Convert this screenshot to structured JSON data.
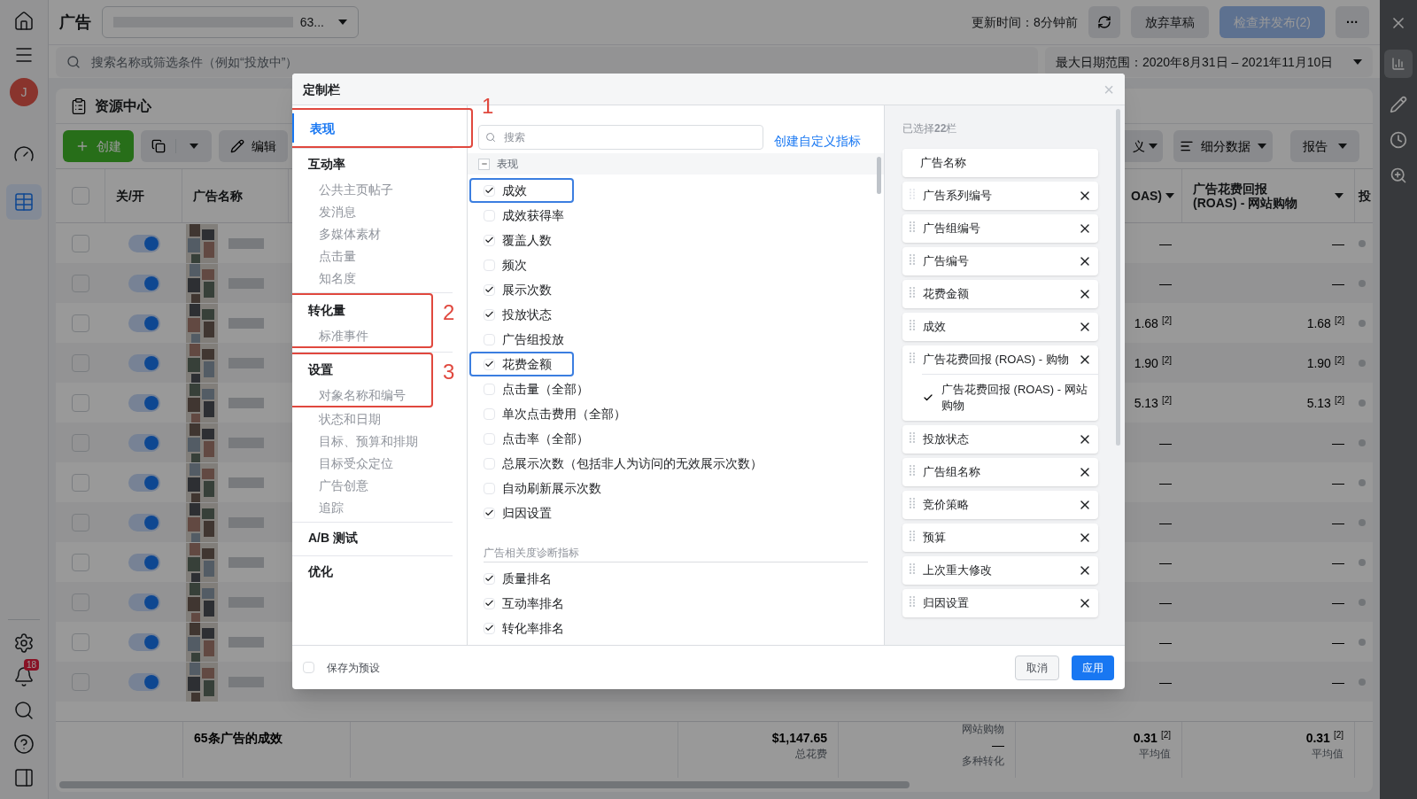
{
  "app_rail": {
    "avatar": "J",
    "notification_badge": "18",
    "items": [
      {
        "kind": "gauge",
        "selected": false
      },
      {
        "kind": "table",
        "selected": true
      }
    ]
  },
  "header": {
    "title": "广告",
    "account_select": "63...",
    "update_time": "更新时间：8分钟前",
    "discard_button": "放弃草稿",
    "publish_button": {
      "label": "检查并发布(2)",
      "disabled": true
    },
    "more_button": "···"
  },
  "search": {
    "placeholder": "搜索名称或筛选条件（例如“投放中”）",
    "date_range": "最大日期范围：2020年8月31日 – 2021年11月10日"
  },
  "resource_center": "资源中心",
  "toolbar": {
    "create": "创建",
    "edit": "编辑",
    "right_buttons": [
      "义",
      "细分数据",
      "报告"
    ]
  },
  "table": {
    "columns": [
      "关/开",
      "广告名称",
      "OAS)",
      "广告花费回报\n(ROAS) - 网站购物",
      "投"
    ],
    "rows": [
      {
        "checked": false,
        "on": true,
        "column_3": "—",
        "column_4": "—"
      },
      {
        "checked": false,
        "on": true,
        "column_3": "—",
        "column_4": "—"
      },
      {
        "checked": false,
        "on": true,
        "column_3": "1.68",
        "note_3": "[2]",
        "column_4": "1.68",
        "note_4": "[2]"
      },
      {
        "checked": false,
        "on": true,
        "column_3": "1.90",
        "note_3": "[2]",
        "column_4": "1.90",
        "note_4": "[2]"
      },
      {
        "checked": false,
        "on": true,
        "column_3": "5.13",
        "note_3": "[2]",
        "column_4": "5.13",
        "note_4": "[2]"
      },
      {
        "checked": false,
        "on": true,
        "column_3": "—",
        "column_4": "—"
      },
      {
        "checked": false,
        "on": true,
        "column_3": "—",
        "column_4": "—"
      },
      {
        "checked": false,
        "on": true,
        "column_3": "—",
        "column_4": "—"
      },
      {
        "checked": false,
        "on": true,
        "column_3": "—",
        "column_4": "—"
      },
      {
        "checked": false,
        "on": true,
        "column_3": "—",
        "column_4": "—"
      },
      {
        "checked": false,
        "on": true,
        "column_3": "—",
        "column_4": "—"
      },
      {
        "checked": false,
        "on": true,
        "column_3": "—",
        "column_4": "—"
      }
    ],
    "all_checked": false,
    "footer": {
      "summary": "65条广告的成效",
      "spend": "$1,147.65",
      "spend_label": "总花费",
      "peek": "网站购物",
      "conversions": "—",
      "conversions_label": "多种转化",
      "roas_1": "0.31",
      "note_1": "[2]",
      "average_label_1": "平均值",
      "roas_2": "0.31",
      "note_2": "[2]",
      "average_label_2": "平均值"
    }
  },
  "dialog": {
    "title": "定制栏",
    "close": "×",
    "nav": [
      {
        "label": "表现",
        "selected": true,
        "annotation": "1"
      },
      {
        "label": "互动率",
        "selected": false,
        "items": [
          "公共主页帖子",
          "发消息",
          "多媒体素材",
          "点击量",
          "知名度"
        ]
      },
      {
        "label": "转化量",
        "selected": false,
        "annotation": "2",
        "items": [
          "标准事件"
        ]
      },
      {
        "label": "设置",
        "selected": false,
        "annotation": "3",
        "items": [
          "对象名称和编号",
          "状态和日期",
          "目标、预算和排期",
          "目标受众定位",
          "广告创意",
          "追踪"
        ]
      },
      {
        "label": "A/B 测试",
        "selected": false
      },
      {
        "label": "优化",
        "selected": false
      }
    ],
    "search_placeholder": "搜索",
    "create_metric_link": "创建自定义指标",
    "sections": [
      {
        "title": "表现",
        "kind": "collapsible",
        "metrics": [
          {
            "label": "成效",
            "checked": true,
            "highlighted": true
          },
          {
            "label": "成效获得率",
            "checked": false,
            "highlighted": false
          },
          {
            "label": "覆盖人数",
            "checked": true,
            "highlighted": false
          },
          {
            "label": "频次",
            "checked": false,
            "highlighted": false
          },
          {
            "label": "展示次数",
            "checked": true,
            "highlighted": false
          },
          {
            "label": "投放状态",
            "checked": true,
            "highlighted": false
          },
          {
            "label": "广告组投放",
            "checked": false,
            "highlighted": false
          },
          {
            "label": "花费金额",
            "checked": true,
            "highlighted": true
          },
          {
            "label": "点击量（全部）",
            "checked": false,
            "highlighted": false
          },
          {
            "label": "单次点击费用（全部）",
            "checked": false,
            "highlighted": false
          },
          {
            "label": "点击率（全部）",
            "checked": false,
            "highlighted": false
          },
          {
            "label": "总展示次数（包括非人为访问的无效展示次数）",
            "checked": false,
            "highlighted": false
          },
          {
            "label": "自动刷新展示次数",
            "checked": false,
            "highlighted": false
          },
          {
            "label": "归因设置",
            "checked": true,
            "highlighted": false
          }
        ]
      },
      {
        "title": "广告相关度诊断指标",
        "kind": "plain",
        "metrics": [
          {
            "label": "质量排名",
            "checked": true,
            "highlighted": false
          },
          {
            "label": "互动率排名",
            "checked": true,
            "highlighted": false
          },
          {
            "label": "转化率排名",
            "checked": true,
            "highlighted": false
          }
        ]
      }
    ],
    "selected_count": "已选择**22**栏",
    "selected_columns": [
      {
        "label": "广告名称",
        "locked": true
      },
      {
        "label": "广告系列编号",
        "locked": false
      },
      {
        "label": "广告组编号",
        "locked": false
      },
      {
        "label": "广告编号",
        "locked": false
      },
      {
        "label": "花费金额",
        "locked": false
      },
      {
        "label": "成效",
        "locked": false
      },
      {
        "label": "广告花费回报 (ROAS) - 购物",
        "locked": false,
        "children": [
          {
            "label": "广告花费回报 (ROAS) - 网站购物",
            "checked": true
          }
        ]
      },
      {
        "label": "投放状态",
        "locked": false
      },
      {
        "label": "广告组名称",
        "locked": false
      },
      {
        "label": "竞价策略",
        "locked": false
      },
      {
        "label": "预算",
        "locked": false
      },
      {
        "label": "上次重大修改",
        "locked": false
      },
      {
        "label": "归因设置",
        "locked": false
      }
    ],
    "save_preset": {
      "label": "保存为预设",
      "checked": false
    },
    "cancel": "取消",
    "apply": "应用"
  }
}
